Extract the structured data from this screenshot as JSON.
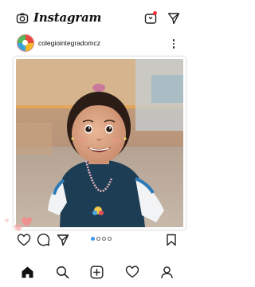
{
  "app": {
    "brand": "Instagram"
  },
  "post": {
    "username": "colegiointegradomcz",
    "carousel": {
      "count": 4,
      "active_index": 0
    }
  },
  "colors": {
    "accent_blue": "#3897f0",
    "notification_red": "#ff3040",
    "heart_pink": "#f58a8a"
  },
  "icons": {
    "top": [
      "camera-icon",
      "igtv-icon",
      "direct-message-icon"
    ],
    "actions": [
      "heart-icon",
      "comment-icon",
      "share-icon",
      "bookmark-icon"
    ],
    "nav": [
      "home-icon",
      "search-icon",
      "add-post-icon",
      "activity-heart-icon",
      "profile-icon"
    ]
  }
}
